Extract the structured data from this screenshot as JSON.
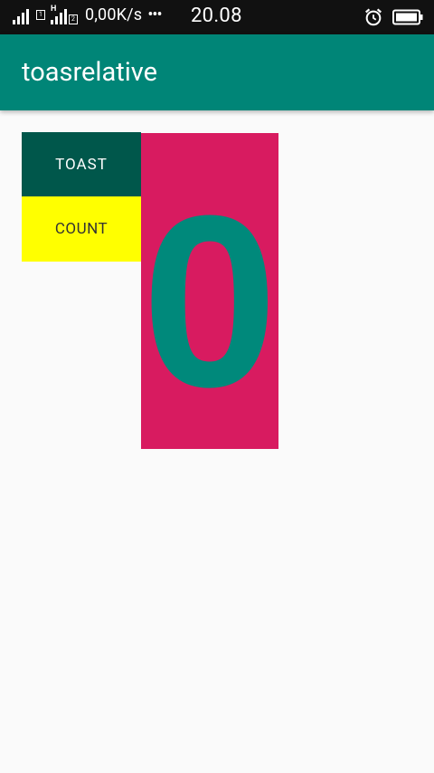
{
  "status_bar": {
    "sim1_badge": "1",
    "sim2_badge": "2",
    "sim2_network": "H",
    "net_speed": "0,00K/s",
    "more_dots": "•••",
    "time": "20.08",
    "icons": [
      "signal-icon",
      "signal-icon",
      "alarm-icon",
      "battery-icon"
    ]
  },
  "app_bar": {
    "title": "toasrelative",
    "color": "#008577"
  },
  "main": {
    "toast_button_label": "Toast",
    "count_button_label": "Count",
    "count_value": "0",
    "colors": {
      "toast_button_bg": "#00574B",
      "count_button_bg": "#FFFF00",
      "count_panel_bg": "#D81B60",
      "count_text": "#00897B"
    }
  }
}
